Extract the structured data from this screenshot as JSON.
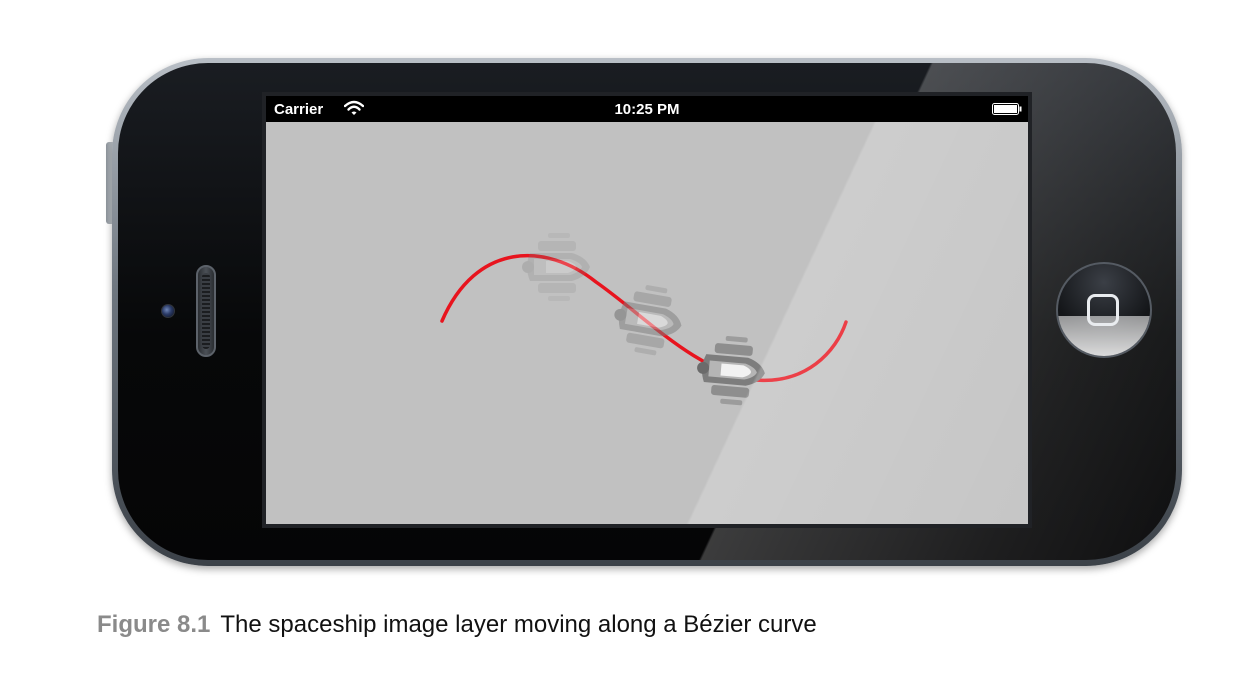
{
  "status_bar": {
    "carrier": "Carrier",
    "time": "10:25 PM"
  },
  "scene": {
    "curve_color": "#e8141e",
    "background_color": "#c1c1c1",
    "sprites": [
      "spaceship-icon",
      "spaceship-icon",
      "spaceship-icon"
    ]
  },
  "caption": {
    "label": "Figure 8.1",
    "text": "The spaceship image layer moving along a Bézier curve"
  }
}
